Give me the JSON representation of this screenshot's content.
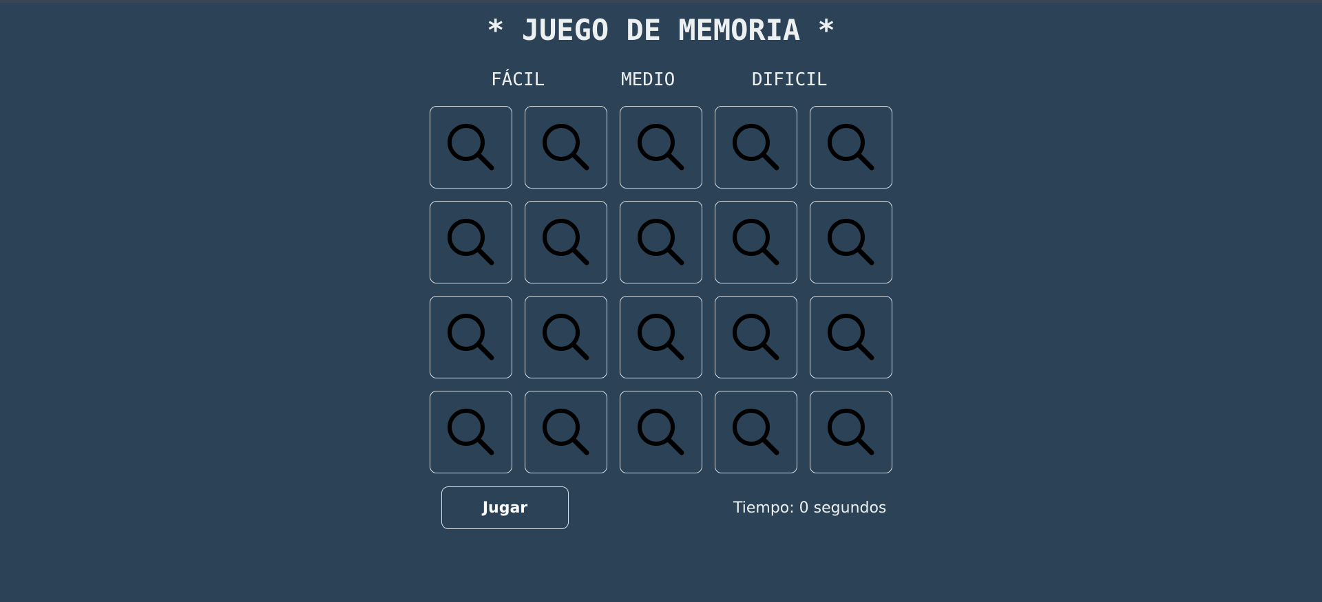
{
  "title": "* JUEGO DE MEMORIA *",
  "levels": [
    "FÁCIL",
    "MEDIO",
    "DIFICIL"
  ],
  "board": {
    "rows": 4,
    "columns": 5,
    "card_icon": "search-icon",
    "card_icon_color": "#000000"
  },
  "controls": {
    "play_label": "Jugar",
    "timer_text": "Tiempo: 0 segundos"
  },
  "colors": {
    "background": "#2c4256",
    "text": "#ecf0f1",
    "card_border": "#d6dde3"
  }
}
